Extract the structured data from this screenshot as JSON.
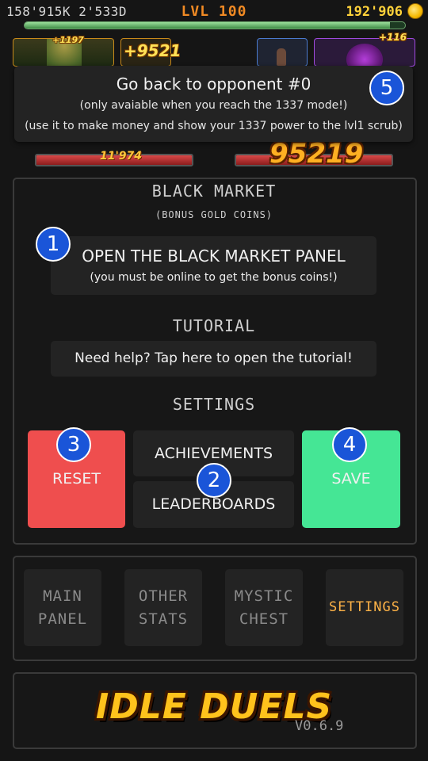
{
  "topbar": {
    "stats": "158'915K 2'533D",
    "level": "LVL 100",
    "gold": "192'906",
    "xp_progress": 0.96
  },
  "battle": {
    "float_small": "+1197",
    "float_big": "+9521",
    "float_right": "+116",
    "hp_left_value": "11'974",
    "damage_big": "95219",
    "hp_left_fraction": 1.0,
    "hp_right_fraction": 1.0
  },
  "tooltip": {
    "title": "Go back to opponent #0",
    "line1": "(only avaiable when you reach the 1337 mode!)",
    "line2": "(use it to make money and show your 1337 power to the lvl1 scrub)"
  },
  "black_market": {
    "heading": "BLACK MARKET",
    "subheading": "(BONUS GOLD COINS)",
    "button_title": "OPEN THE BLACK MARKET PANEL",
    "button_note": "(you must be online to get the bonus coins!)"
  },
  "tutorial": {
    "heading": "TUTORIAL",
    "button": "Need help? Tap here to open the tutorial!"
  },
  "settings": {
    "heading": "SETTINGS",
    "reset": "RESET",
    "achievements": "ACHIEVEMENTS",
    "leaderboards": "LEADERBOARDS",
    "save": "SAVE"
  },
  "nav": {
    "main_panel": "MAIN PANEL",
    "other_stats": "OTHER STATS",
    "mystic_chest": "MYSTIC CHEST",
    "settings": "SETTINGS"
  },
  "footer": {
    "logo": "IDLE DUELS",
    "version": "V0.6.9"
  },
  "callouts": {
    "one": "1",
    "two": "2",
    "three": "3",
    "four": "4",
    "five": "5"
  },
  "colors": {
    "accent_orange": "#f08a24",
    "gold": "#ffd23a",
    "reset_red": "#ef4e4e",
    "save_green": "#45e695",
    "callout_blue": "#1a55d8"
  }
}
